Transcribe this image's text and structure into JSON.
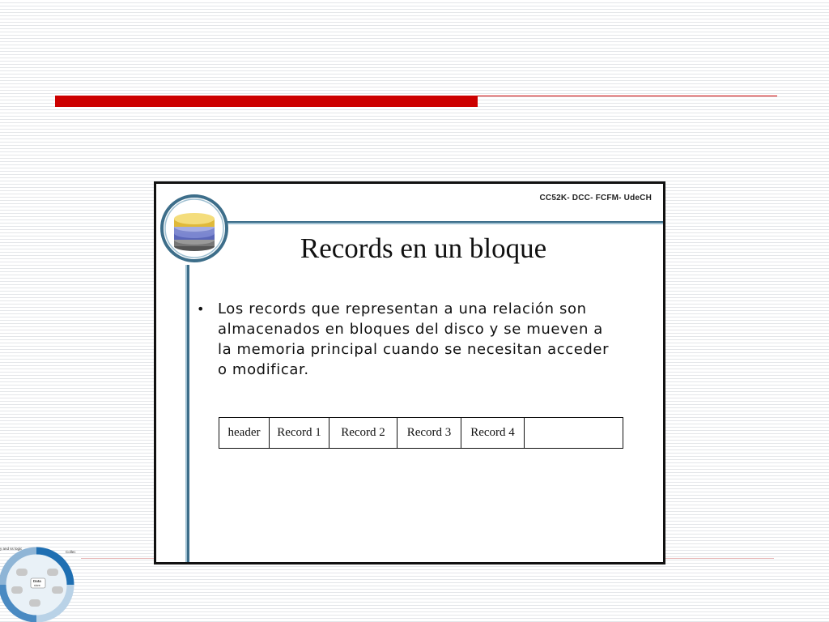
{
  "slide": {
    "course_tag": "CC52K- DCC- FCFM- UdeCH",
    "title": "Records en un bloque",
    "bullet": "Los records que representan a una relación son almacenados en bloques del disco y se mueven a la memoria principal cuando se necesitan acceder o modificar.",
    "table_cells": [
      "header",
      "Record 1",
      "Record 2",
      "Record 3",
      "Record 4",
      ""
    ]
  },
  "cycle_graphic": {
    "label_top_left": "y and\nss logic",
    "label_top_right": "Collec",
    "label_center": "Data",
    "label_center_sub": "store"
  },
  "colors": {
    "accent_red": "#cc0000",
    "slide_blue": "#3d6e8a"
  },
  "icons": {
    "logo": "disk-stack-icon",
    "cycle": "database-cycle-graphic"
  }
}
